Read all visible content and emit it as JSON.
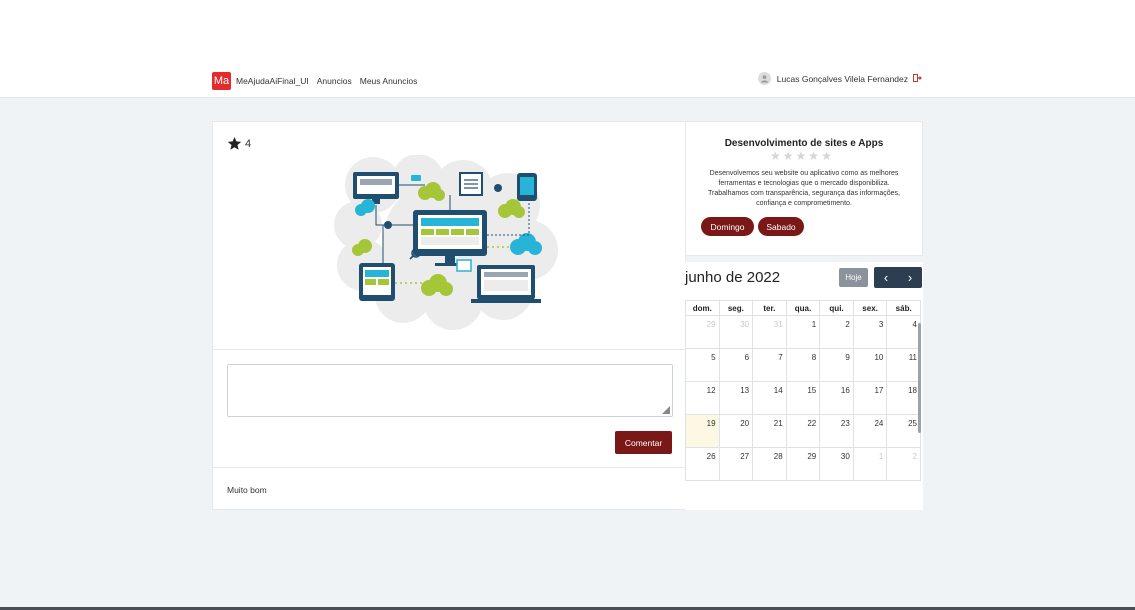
{
  "navbar": {
    "brand_badge": "Ma",
    "brand_name": "MeAjudaAiFinal_UI",
    "links": [
      "Anuncios",
      "Meus Anuncios"
    ],
    "user_name": "Lucas Gonçalves Vilela Fernandez"
  },
  "listing": {
    "rating_value": "4",
    "comment_placeholder": "",
    "comment_button": "Comentar",
    "comments": [
      "Muito bom"
    ]
  },
  "info": {
    "title": "Desenvolvimento de sites e Apps",
    "stars_filled": 0,
    "stars_total": 5,
    "description": "Desenvolvemos seu website ou aplicativo como as melhores ferramentas e tecnologias que o mercado disponibiliza. Trabalhamos com transparência, segurança das informações, confiança e comprometimento.",
    "days": [
      "Domingo",
      "Sabado"
    ]
  },
  "calendar": {
    "title": "junho de 2022",
    "today_button": "Hoje",
    "prev_icon": "‹",
    "next_icon": "›",
    "weekdays": [
      "dom.",
      "seg.",
      "ter.",
      "qua.",
      "qui.",
      "sex.",
      "sáb."
    ],
    "weeks": [
      [
        "29",
        "30",
        "31",
        "1",
        "2",
        "3",
        "4"
      ],
      [
        "5",
        "6",
        "7",
        "8",
        "9",
        "10",
        "11"
      ],
      [
        "12",
        "13",
        "14",
        "15",
        "16",
        "17",
        "18"
      ],
      [
        "19",
        "20",
        "21",
        "22",
        "23",
        "24",
        "25"
      ],
      [
        "26",
        "27",
        "28",
        "29",
        "30",
        "1",
        "2"
      ]
    ],
    "today": "19"
  },
  "colors": {
    "brand_red": "#e32b2b",
    "button_maroon": "#7a1717",
    "nav_dark": "#2c3e50",
    "today_highlight": "#fcf8e3"
  }
}
